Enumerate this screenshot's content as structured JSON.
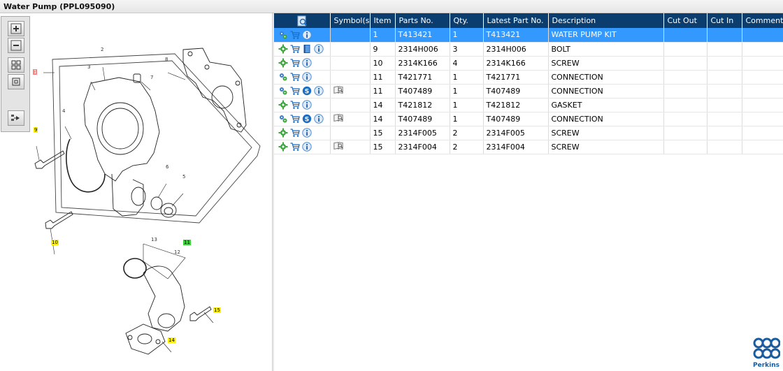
{
  "window": {
    "title": "Water Pump (PPL095090)"
  },
  "table": {
    "headers": {
      "tools": "",
      "symbols": "Symbol(s)",
      "item": "Item",
      "parts_no": "Parts No.",
      "qty": "Qty.",
      "latest_part_no": "Latest Part No.",
      "description": "Description",
      "cut_out": "Cut Out",
      "cut_in": "Cut In",
      "comment": "Comment"
    },
    "rows": [
      {
        "item": "1",
        "parts_no": "T413421",
        "qty": "1",
        "latest": "T413421",
        "description": "WATER PUMP KIT",
        "icons": [
          "settings-icon",
          "cart-icon",
          "info-icon"
        ],
        "symbol": "",
        "selected": true
      },
      {
        "item": "9",
        "parts_no": "2314H006",
        "qty": "3",
        "latest": "2314H006",
        "description": "BOLT",
        "icons": [
          "gear-icon",
          "cart-icon",
          "book-icon",
          "info-icon"
        ],
        "symbol": ""
      },
      {
        "item": "10",
        "parts_no": "2314K166",
        "qty": "4",
        "latest": "2314K166",
        "description": "SCREW",
        "icons": [
          "gear-icon",
          "cart-icon",
          "info-icon"
        ],
        "symbol": ""
      },
      {
        "item": "11",
        "parts_no": "T421771",
        "qty": "1",
        "latest": "T421771",
        "description": "CONNECTION",
        "icons": [
          "settings-icon",
          "cart-icon",
          "info-icon"
        ],
        "symbol": ""
      },
      {
        "item": "11",
        "parts_no": "T407489",
        "qty": "1",
        "latest": "T407489",
        "description": "CONNECTION",
        "icons": [
          "settings-icon",
          "cart-icon",
          "s-icon",
          "info-icon"
        ],
        "symbol": "manual-icon"
      },
      {
        "item": "14",
        "parts_no": "T421812",
        "qty": "1",
        "latest": "T421812",
        "description": "GASKET",
        "icons": [
          "gear-icon",
          "cart-icon",
          "info-icon"
        ],
        "symbol": ""
      },
      {
        "item": "14",
        "parts_no": "T407489",
        "qty": "1",
        "latest": "T407489",
        "description": "CONNECTION",
        "icons": [
          "settings-icon",
          "cart-icon",
          "s-icon",
          "info-icon"
        ],
        "symbol": "manual-icon"
      },
      {
        "item": "15",
        "parts_no": "2314F005",
        "qty": "2",
        "latest": "2314F005",
        "description": "SCREW",
        "icons": [
          "gear-icon",
          "cart-icon",
          "info-icon"
        ],
        "symbol": ""
      },
      {
        "item": "15",
        "parts_no": "2314F004",
        "qty": "2",
        "latest": "2314F004",
        "description": "SCREW",
        "icons": [
          "gear-icon",
          "cart-icon",
          "info-icon"
        ],
        "symbol": "manual-icon"
      }
    ]
  },
  "diagram": {
    "callouts": {
      "c1": "1",
      "c9": "9",
      "c10": "10",
      "c11": "11",
      "c14": "14",
      "c15": "15"
    },
    "numbers": {
      "n2": "2",
      "n3": "3",
      "n4": "4",
      "n5": "5",
      "n6": "6",
      "n7": "7",
      "n8": "8",
      "n12": "12",
      "n13": "13"
    }
  },
  "brand": {
    "name": "Perkins",
    "color": "#1a5c9e"
  },
  "colors": {
    "header_bg": "#0b3d6e",
    "selected_row": "#3399ff",
    "callout_yellow": "#fff200",
    "callout_green": "#37d637"
  }
}
